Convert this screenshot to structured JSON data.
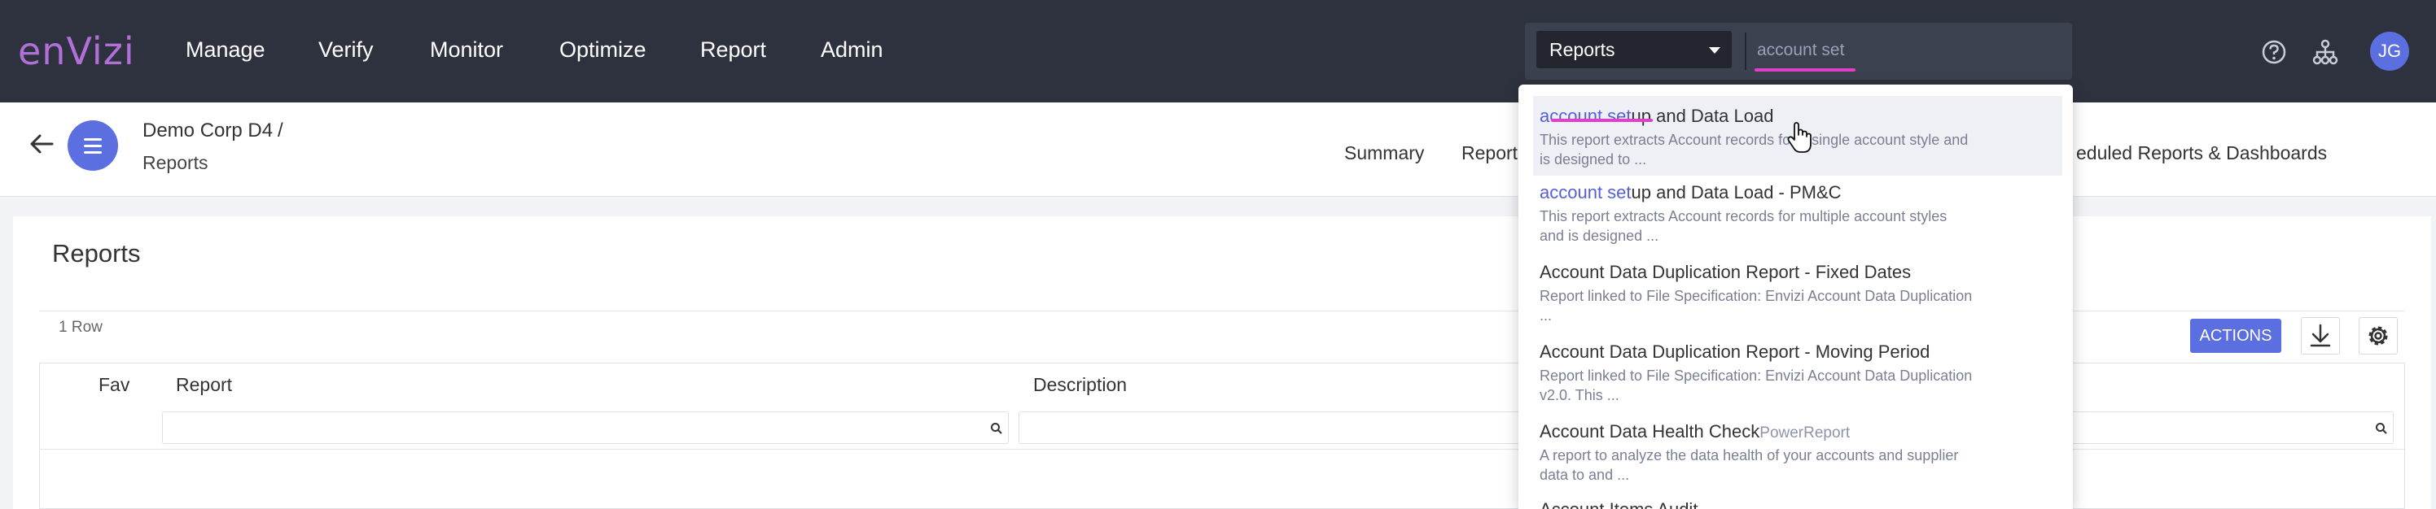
{
  "topbar": {
    "logo": "enVizi",
    "nav": [
      "Manage",
      "Verify",
      "Monitor",
      "Optimize",
      "Report",
      "Admin"
    ],
    "search_scope": "Reports",
    "search_query": "account set",
    "avatar_initials": "JG"
  },
  "subheader": {
    "org": "Demo Corp D4",
    "separator": "/",
    "page": "Reports",
    "tabs": [
      "Summary",
      "Report",
      "eduled Reports & Dashboards"
    ]
  },
  "main": {
    "title": "Reports",
    "row_count": "1 Row",
    "actions_label": "ACTIONS",
    "columns": [
      "Fav",
      "Report",
      "Description"
    ]
  },
  "dropdown": {
    "items": [
      {
        "highlight": "account set",
        "rest": "up and Data Load",
        "tag": "",
        "desc": [
          "This report extracts Account records for a single account style and",
          "is designed to ..."
        ]
      },
      {
        "highlight": "account set",
        "rest": "up and Data Load - PM&C",
        "tag": "",
        "desc": [
          "This report extracts Account records for multiple account styles",
          "and is designed ..."
        ]
      },
      {
        "highlight": "",
        "rest": "Account Data Duplication Report - Fixed Dates",
        "tag": "",
        "desc": [
          "Report linked to File Specification: Envizi Account Data Duplication",
          "..."
        ]
      },
      {
        "highlight": "",
        "rest": "Account Data Duplication Report - Moving Period",
        "tag": "",
        "desc": [
          "Report linked to File Specification: Envizi Account Data Duplication",
          "v2.0. This ..."
        ]
      },
      {
        "highlight": "",
        "rest": "Account Data Health Check",
        "tag": "PowerReport",
        "desc": [
          "A report to analyze the data health of your accounts and supplier",
          "data to and ..."
        ]
      },
      {
        "highlight": "",
        "rest": "Account Items Audit",
        "tag": "",
        "desc": []
      }
    ]
  },
  "colors": {
    "topbar": "#2e323e",
    "accent": "#5b6fe0",
    "logo": "#b070d8",
    "highlight_underline": "#e040c8"
  },
  "icons": [
    "help-icon",
    "org-hierarchy-icon",
    "back-arrow-icon",
    "menu-icon",
    "download-icon",
    "settings-icon",
    "search-icon",
    "hand-cursor-icon"
  ]
}
